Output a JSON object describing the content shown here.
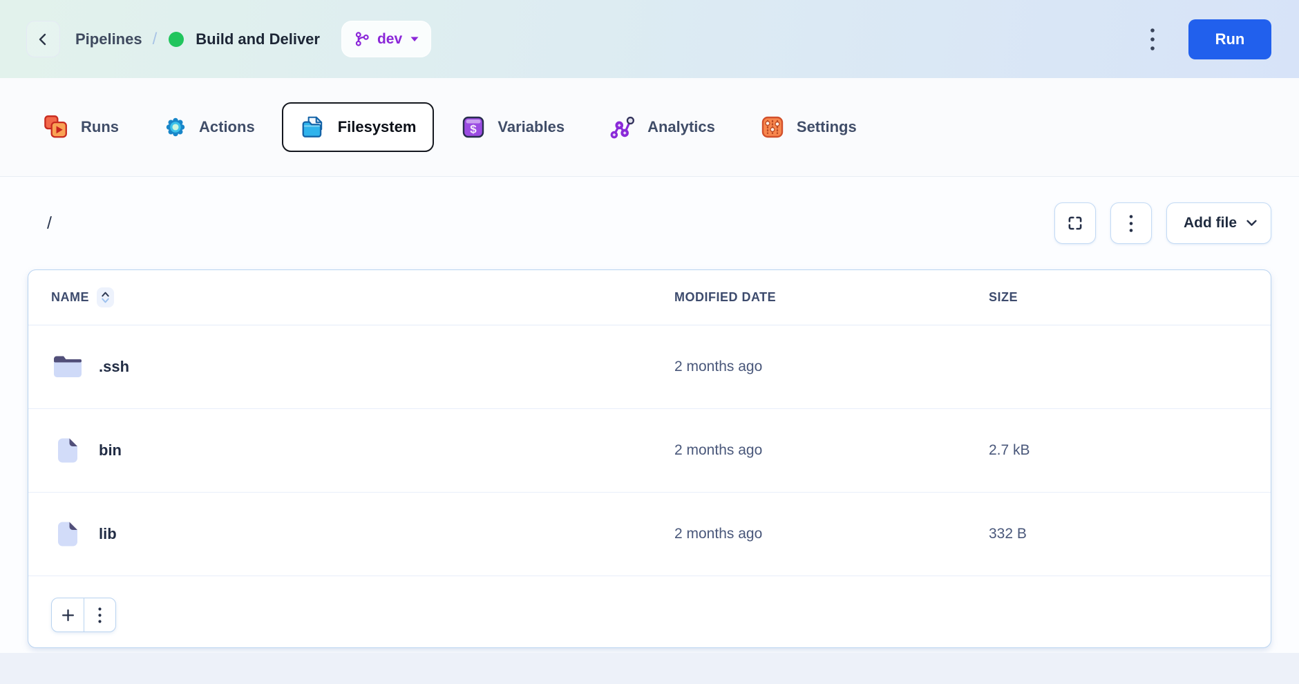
{
  "header": {
    "breadcrumb": "Pipelines",
    "separator": "/",
    "pipeline_name": "Build and Deliver",
    "branch": "dev",
    "run_label": "Run"
  },
  "tabs": [
    {
      "label": "Runs",
      "icon": "runs-icon",
      "active": false
    },
    {
      "label": "Actions",
      "icon": "actions-icon",
      "active": false
    },
    {
      "label": "Filesystem",
      "icon": "filesystem-icon",
      "active": true
    },
    {
      "label": "Variables",
      "icon": "variables-icon",
      "active": false
    },
    {
      "label": "Analytics",
      "icon": "analytics-icon",
      "active": false
    },
    {
      "label": "Settings",
      "icon": "settings-icon",
      "active": false
    }
  ],
  "toolbar": {
    "path": "/",
    "add_file_label": "Add file"
  },
  "table": {
    "columns": [
      "NAME",
      "MODIFIED DATE",
      "SIZE"
    ],
    "rows": [
      {
        "name": ".ssh",
        "type": "folder",
        "modified": "2 months ago",
        "size": ""
      },
      {
        "name": "bin",
        "type": "file",
        "modified": "2 months ago",
        "size": "2.7 kB"
      },
      {
        "name": "lib",
        "type": "file",
        "modified": "2 months ago",
        "size": "332 B"
      }
    ]
  },
  "colors": {
    "run_button": "#2160ed",
    "branch_accent": "#8b27d8",
    "status_green": "#21c55d",
    "card_border": "#b9d3f0",
    "header_gradient_left": "#e2f2ec",
    "header_gradient_right": "#d7e3f8"
  }
}
